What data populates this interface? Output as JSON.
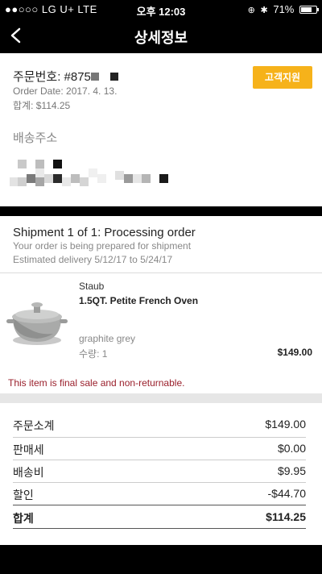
{
  "status_bar": {
    "carrier": "●●○○○ LG U+  LTE",
    "time": "오후 12:03",
    "battery": "71%",
    "battery_level": 0.71
  },
  "nav": {
    "title": "상세정보",
    "back_icon": "chevron-left-icon"
  },
  "order": {
    "number_label": "주문번호: #875",
    "date": "Order Date: 2017. 4. 13.",
    "total": "합계: $114.25",
    "support_button": "고객지원"
  },
  "shipping": {
    "address_label": "배송주소"
  },
  "shipment": {
    "title": "Shipment 1 of 1: Processing order",
    "status_text": "Your order is being prepared for shipment",
    "estimated_delivery": "Estimated delivery 5/12/17 to 5/24/17"
  },
  "item": {
    "brand": "Staub",
    "name": "1.5QT. Petite French Oven",
    "color": "graphite grey",
    "quantity": "수량: 1",
    "price": "$149.00",
    "notice": "This item is final sale and non-returnable."
  },
  "summary": {
    "rows": [
      {
        "label": "주문소계",
        "value": "$149.00"
      },
      {
        "label": "판매세",
        "value": "$0.00"
      },
      {
        "label": "배송비",
        "value": "$9.95"
      },
      {
        "label": "할인",
        "value": "-$44.70"
      },
      {
        "label": "합계",
        "value": "$114.25"
      }
    ]
  },
  "colors": {
    "accent": "#f6b21a",
    "warning_text": "#9a1f2b",
    "header_bg": "#000000"
  }
}
